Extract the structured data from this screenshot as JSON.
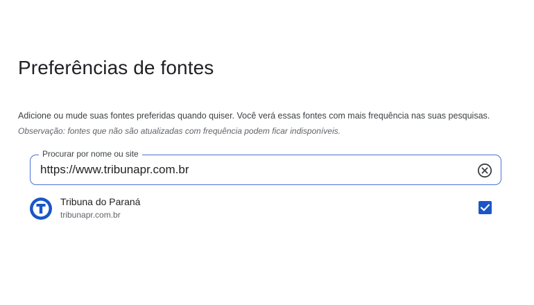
{
  "page": {
    "title": "Preferências de fontes",
    "description": "Adicione ou mude suas fontes preferidas quando quiser. Você verá essas fontes com mais frequência nas suas pesquisas.",
    "note_prefix": "Observação:",
    "note_text": " fontes que não são atualizadas com frequência podem ficar indisponíveis."
  },
  "search": {
    "label": "Procurar por nome ou site",
    "value": "https://www.tribunapr.com.br"
  },
  "results": [
    {
      "name": "Tribuna do Paraná",
      "domain": "tribunapr.com.br",
      "checked": true,
      "logo_letter": "T",
      "logo_color": "#1a56c6"
    }
  ],
  "colors": {
    "accent": "#1a56c6",
    "field_border": "#4a6fd8"
  },
  "icons": {
    "clear": "clear-circle-x-icon",
    "check": "check-icon"
  }
}
